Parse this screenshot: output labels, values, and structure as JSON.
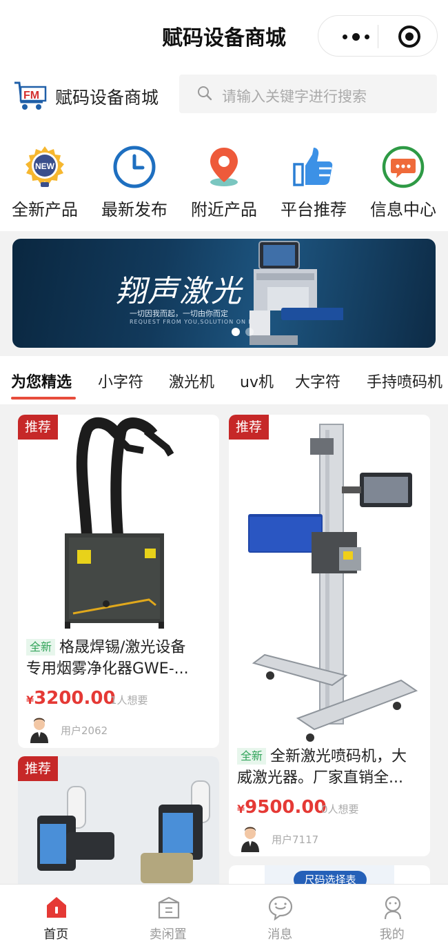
{
  "window": {
    "title": "赋码设备商城"
  },
  "header": {
    "brand": "赋码设备商城",
    "logo_text": "FM",
    "search_placeholder": "请输入关键字进行搜索"
  },
  "categories": [
    {
      "label": "全新产品",
      "icon": "new-gear-icon",
      "badge": "NEW"
    },
    {
      "label": "最新发布",
      "icon": "clock-icon"
    },
    {
      "label": "附近产品",
      "icon": "location-pin-icon"
    },
    {
      "label": "平台推荐",
      "icon": "thumbs-up-icon"
    },
    {
      "label": "信息中心",
      "icon": "message-icon"
    }
  ],
  "banner": {
    "title": "翔声激光",
    "subtitle": "一切因我而起，一切由你而定",
    "subtitle_en": "REQUEST FROM YOU,SOLUTION ON ME"
  },
  "tabs": [
    "为您精选",
    "小字符",
    "激光机",
    "uv机",
    "大字符",
    "手持喷码机"
  ],
  "products": [
    {
      "tag": "推荐",
      "new_tag": "全新",
      "title_line1": "格晟焊锡/激光设备",
      "title_line2": "专用烟雾净化器GWE-...",
      "currency": "¥",
      "price": "3200.00",
      "wants": "1人想要",
      "user": "用户2062"
    },
    {
      "tag": "推荐",
      "new_tag": "全新",
      "title_line1": "全新激光喷码机，大",
      "title_line2": "威激光器。厂家直销全...",
      "currency": "¥",
      "price": "9500.00",
      "wants": "0人想要",
      "user": "用户7117"
    },
    {
      "tag": "推荐"
    },
    {
      "chip_text": "尺码选择表"
    }
  ],
  "nav": [
    {
      "label": "首页",
      "icon": "home-icon",
      "active": true
    },
    {
      "label": "卖闲置",
      "icon": "sell-box-icon"
    },
    {
      "label": "消息",
      "icon": "chat-icon"
    },
    {
      "label": "我的",
      "icon": "profile-icon"
    }
  ],
  "colors": {
    "accent": "#e53935",
    "tag_red": "#c62828",
    "new_green": "#33a45b"
  }
}
